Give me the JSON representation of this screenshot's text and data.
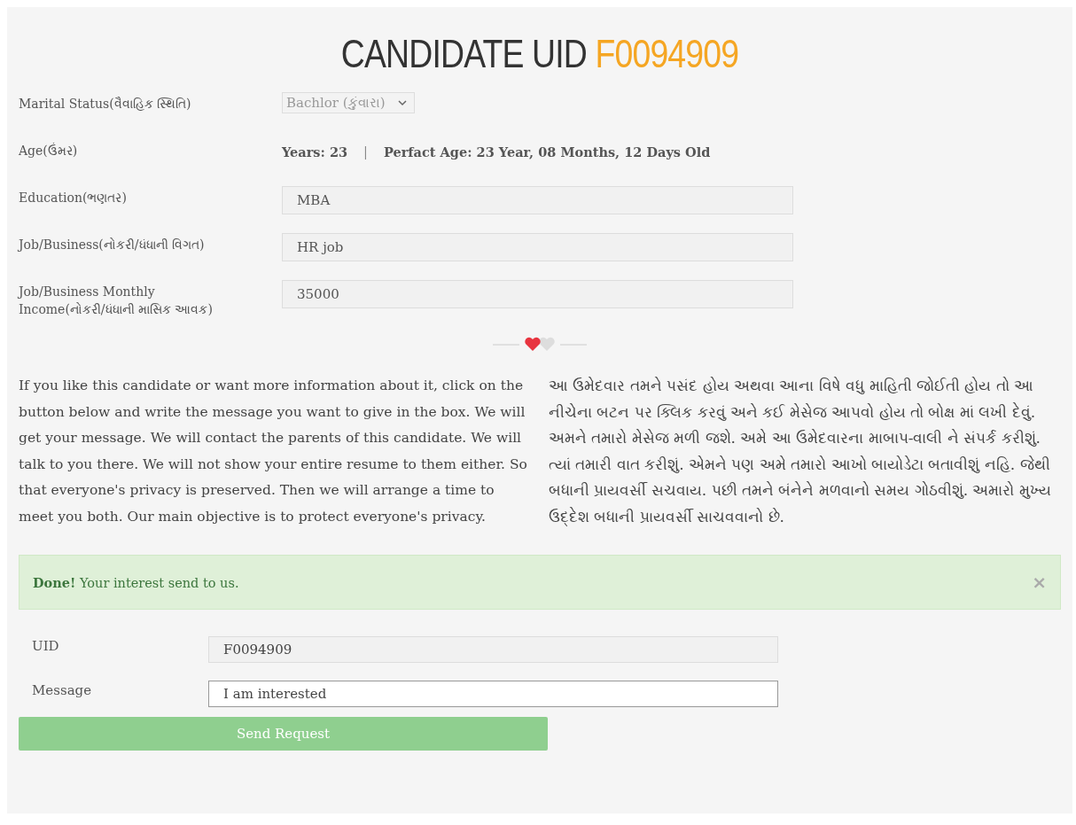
{
  "title": {
    "text": "CANDIDATE UID",
    "uid": "F0094909"
  },
  "details": [
    {
      "kind": "select",
      "label": "Marital Status(વૈવાહિક સ્થિતિ)",
      "value": "Bachlor (કુંવારા)"
    },
    {
      "kind": "age",
      "label": "Age(ઉંમર)",
      "years": "Years: 23",
      "separator": "|",
      "exact": "Perfact Age: 23 Year, 08 Months, 12 Days Old"
    },
    {
      "kind": "field",
      "label": "Education(ભણતર)",
      "value": "MBA"
    },
    {
      "kind": "field",
      "label": "Job/Business(નોકરી/ધંધાની વિગત)",
      "value": "HR job"
    },
    {
      "kind": "field",
      "label": "Job/Business Monthly Income(નોકરી/ધંધાની માસિક આવક)",
      "value": "35000"
    }
  ],
  "info_english": "If you like this candidate or want more information about it, click on the button below and write the message you want to give in the box. We will get your message. We will contact the parents of this candidate. We will talk to you there. We will not show your entire resume to them either. So that everyone's privacy is preserved. Then we will arrange a time to meet you both. Our main objective is to protect everyone's privacy.",
  "info_gujarati": "આ ઉમેદવાર તમને પસંદ હોય અથવા આના વિષે વધુ માહિતી જોઈતી હોય તો આ નીચેના બટન પર ક્લિક કરવું અને કઈ મેસેજ આપવો હોય તો બોક્ષ માં લખી દેવું. અમને તમારો મેસેજ મળી જશે. અમે આ ઉમેદવારના માબાપ-વાલી ને સંપર્ક કરીશું. ત્યાં તમારી વાત કરીશું. એમને પણ અમે તમારો આખો બાયોડેટા બતાવીશું નહિ. જેથી બધાની પ્રાયવર્સી સચવાય. પછી તમને બંનેને મળવાનો સમય ગોઠવીશું. અમારો મુખ્ય ઉદ્દેશ બધાની પ્રાયવર્સી સાચવવાનો છે.",
  "alert": {
    "text": "**Done!** Your interest send to us.",
    "close": "×"
  },
  "request_form": {
    "fields": [
      {
        "label": "UID",
        "value": "F0094909",
        "disabled": true
      },
      {
        "label": "Message",
        "value": "I am interested",
        "disabled": false
      }
    ],
    "button": "Send Request"
  }
}
